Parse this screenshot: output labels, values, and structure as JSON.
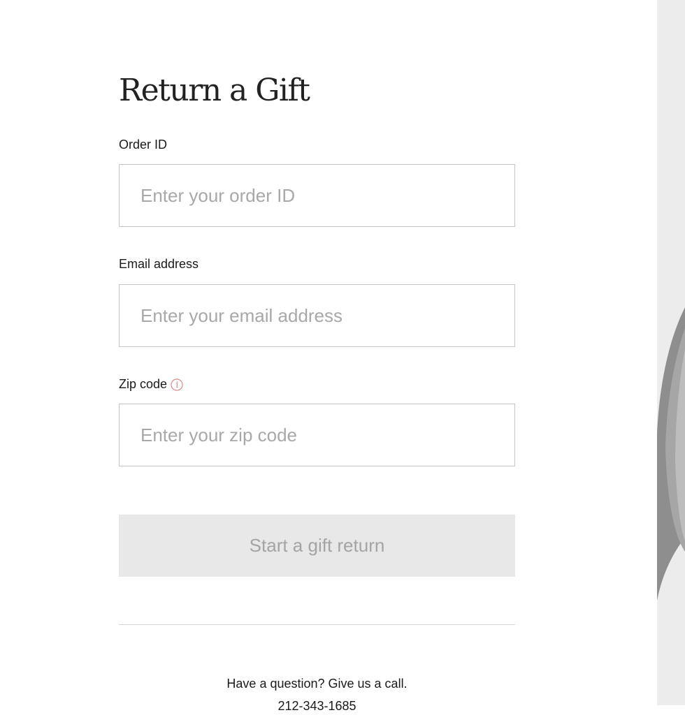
{
  "page": {
    "title": "Return a Gift"
  },
  "form": {
    "order_id": {
      "label": "Order ID",
      "placeholder": "Enter your order ID",
      "value": ""
    },
    "email": {
      "label": "Email address",
      "placeholder": "Enter your email address",
      "value": ""
    },
    "zip": {
      "label": "Zip code",
      "placeholder": "Enter your zip code",
      "value": "",
      "info_icon": "info-circle-icon",
      "info_icon_color": "#d98a86"
    },
    "submit_label": "Start a gift return"
  },
  "help": {
    "question": "Have a question? Give us a call.",
    "phone": "212-343-1685"
  },
  "colors": {
    "button_bg": "#e8e8e8",
    "button_text": "#a4a4a4",
    "input_border": "#c4c4c4",
    "placeholder": "#a8a8a8"
  },
  "side_image": {
    "icon": "product-photo"
  }
}
